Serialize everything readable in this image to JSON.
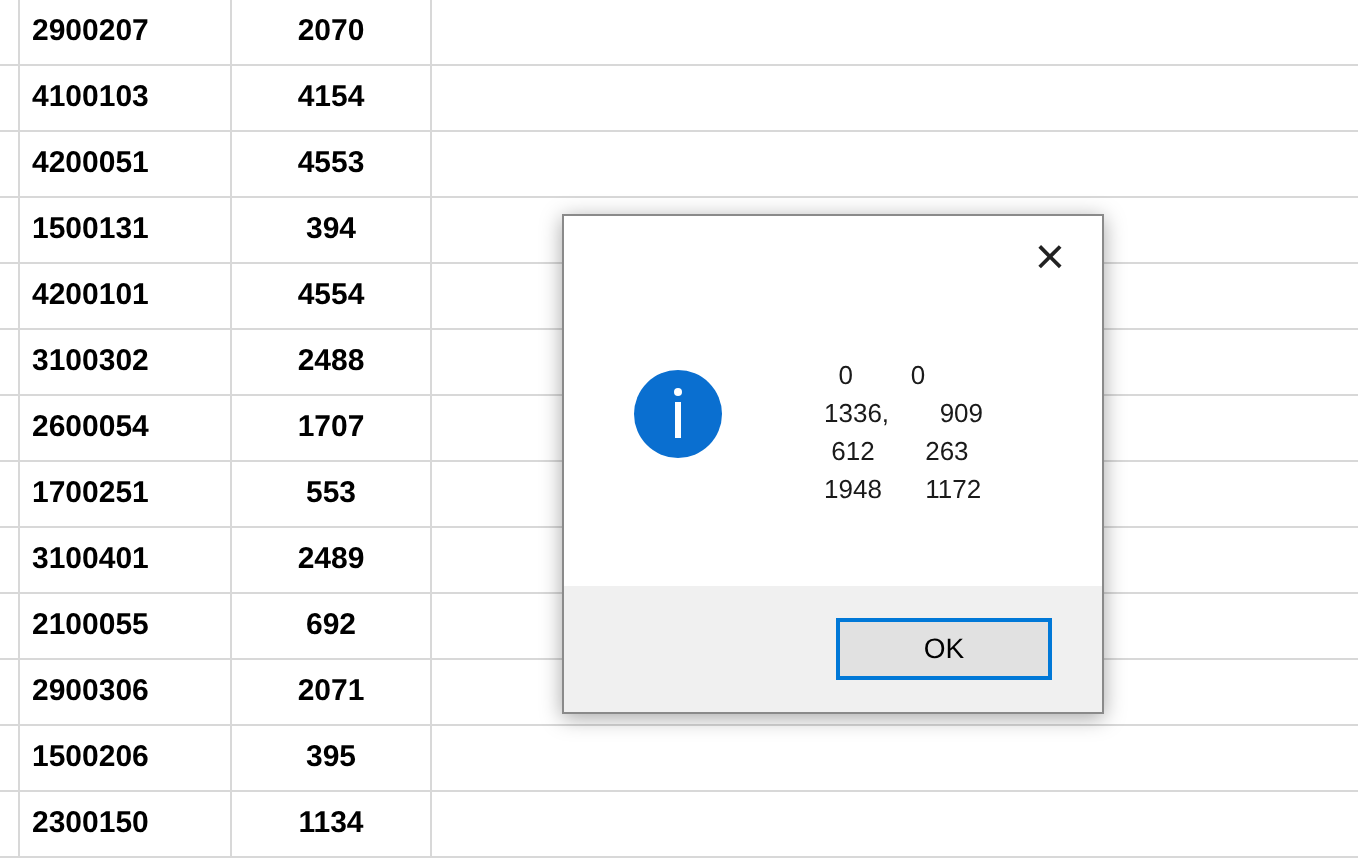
{
  "table": {
    "rows": [
      {
        "column_2": "2900207",
        "column_3": "2070"
      },
      {
        "column_2": "4100103",
        "column_3": "4154"
      },
      {
        "column_2": "4200051",
        "column_3": "4553"
      },
      {
        "column_2": "1500131",
        "column_3": "394"
      },
      {
        "column_2": "4200101",
        "column_3": "4554"
      },
      {
        "column_2": "3100302",
        "column_3": "2488"
      },
      {
        "column_2": "2600054",
        "column_3": "1707"
      },
      {
        "column_2": "1700251",
        "column_3": "553"
      },
      {
        "column_2": "3100401",
        "column_3": "2489"
      },
      {
        "column_2": "2100055",
        "column_3": "692"
      },
      {
        "column_2": "2900306",
        "column_3": "2071"
      },
      {
        "column_2": "1500206",
        "column_3": "395"
      },
      {
        "column_2": "2300150",
        "column_3": "1134"
      }
    ]
  },
  "dialog": {
    "close": "×",
    "message": "  0        0\n1336,       909\n 612       263\n1948      1172",
    "buttons": [
      {
        "label": "OK",
        "selected": true
      }
    ]
  }
}
